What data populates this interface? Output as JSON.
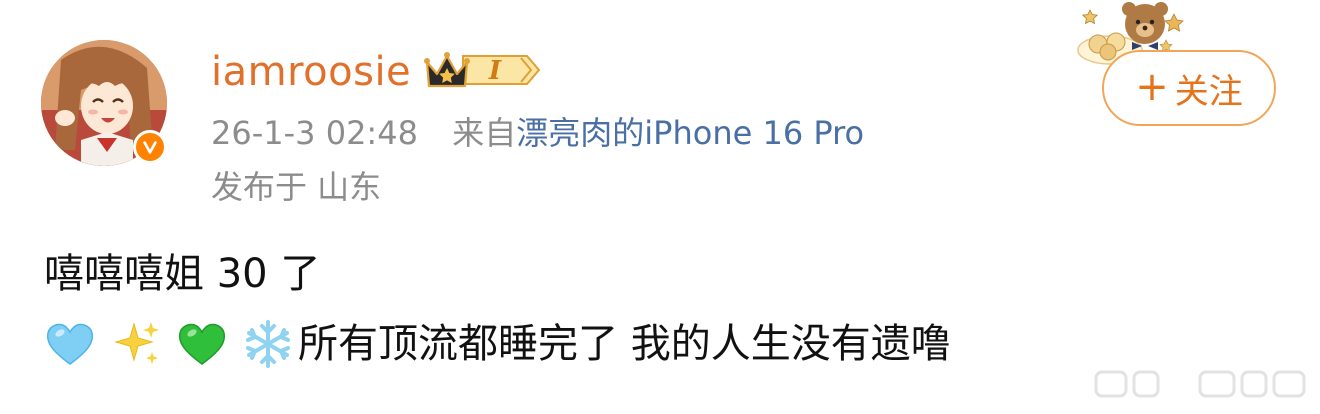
{
  "user": {
    "username": "iamroosie",
    "badge_level": "I",
    "verified": true
  },
  "meta": {
    "datetime": "26-1-3 02:48",
    "from_prefix": "来自",
    "device": "漂亮肉的iPhone 16 Pro",
    "location": "发布于 山东"
  },
  "follow_button": {
    "plus": "+",
    "label": "关注"
  },
  "post": {
    "line1": "嘻嘻嘻姐 30 了",
    "emojis": [
      "light-blue-heart-icon",
      "sparkles-icon",
      "green-heart-icon",
      "snowflake-icon"
    ],
    "line2_text": "所有顶流都睡完了 我的人生没有遗噜"
  },
  "colors": {
    "username": "#e1702b",
    "meta_gray": "#8c8c8c",
    "link_blue": "#4a6fa5",
    "follow_border": "#f3a557",
    "follow_text": "#e5731c",
    "verified_orange": "#ff8200"
  }
}
